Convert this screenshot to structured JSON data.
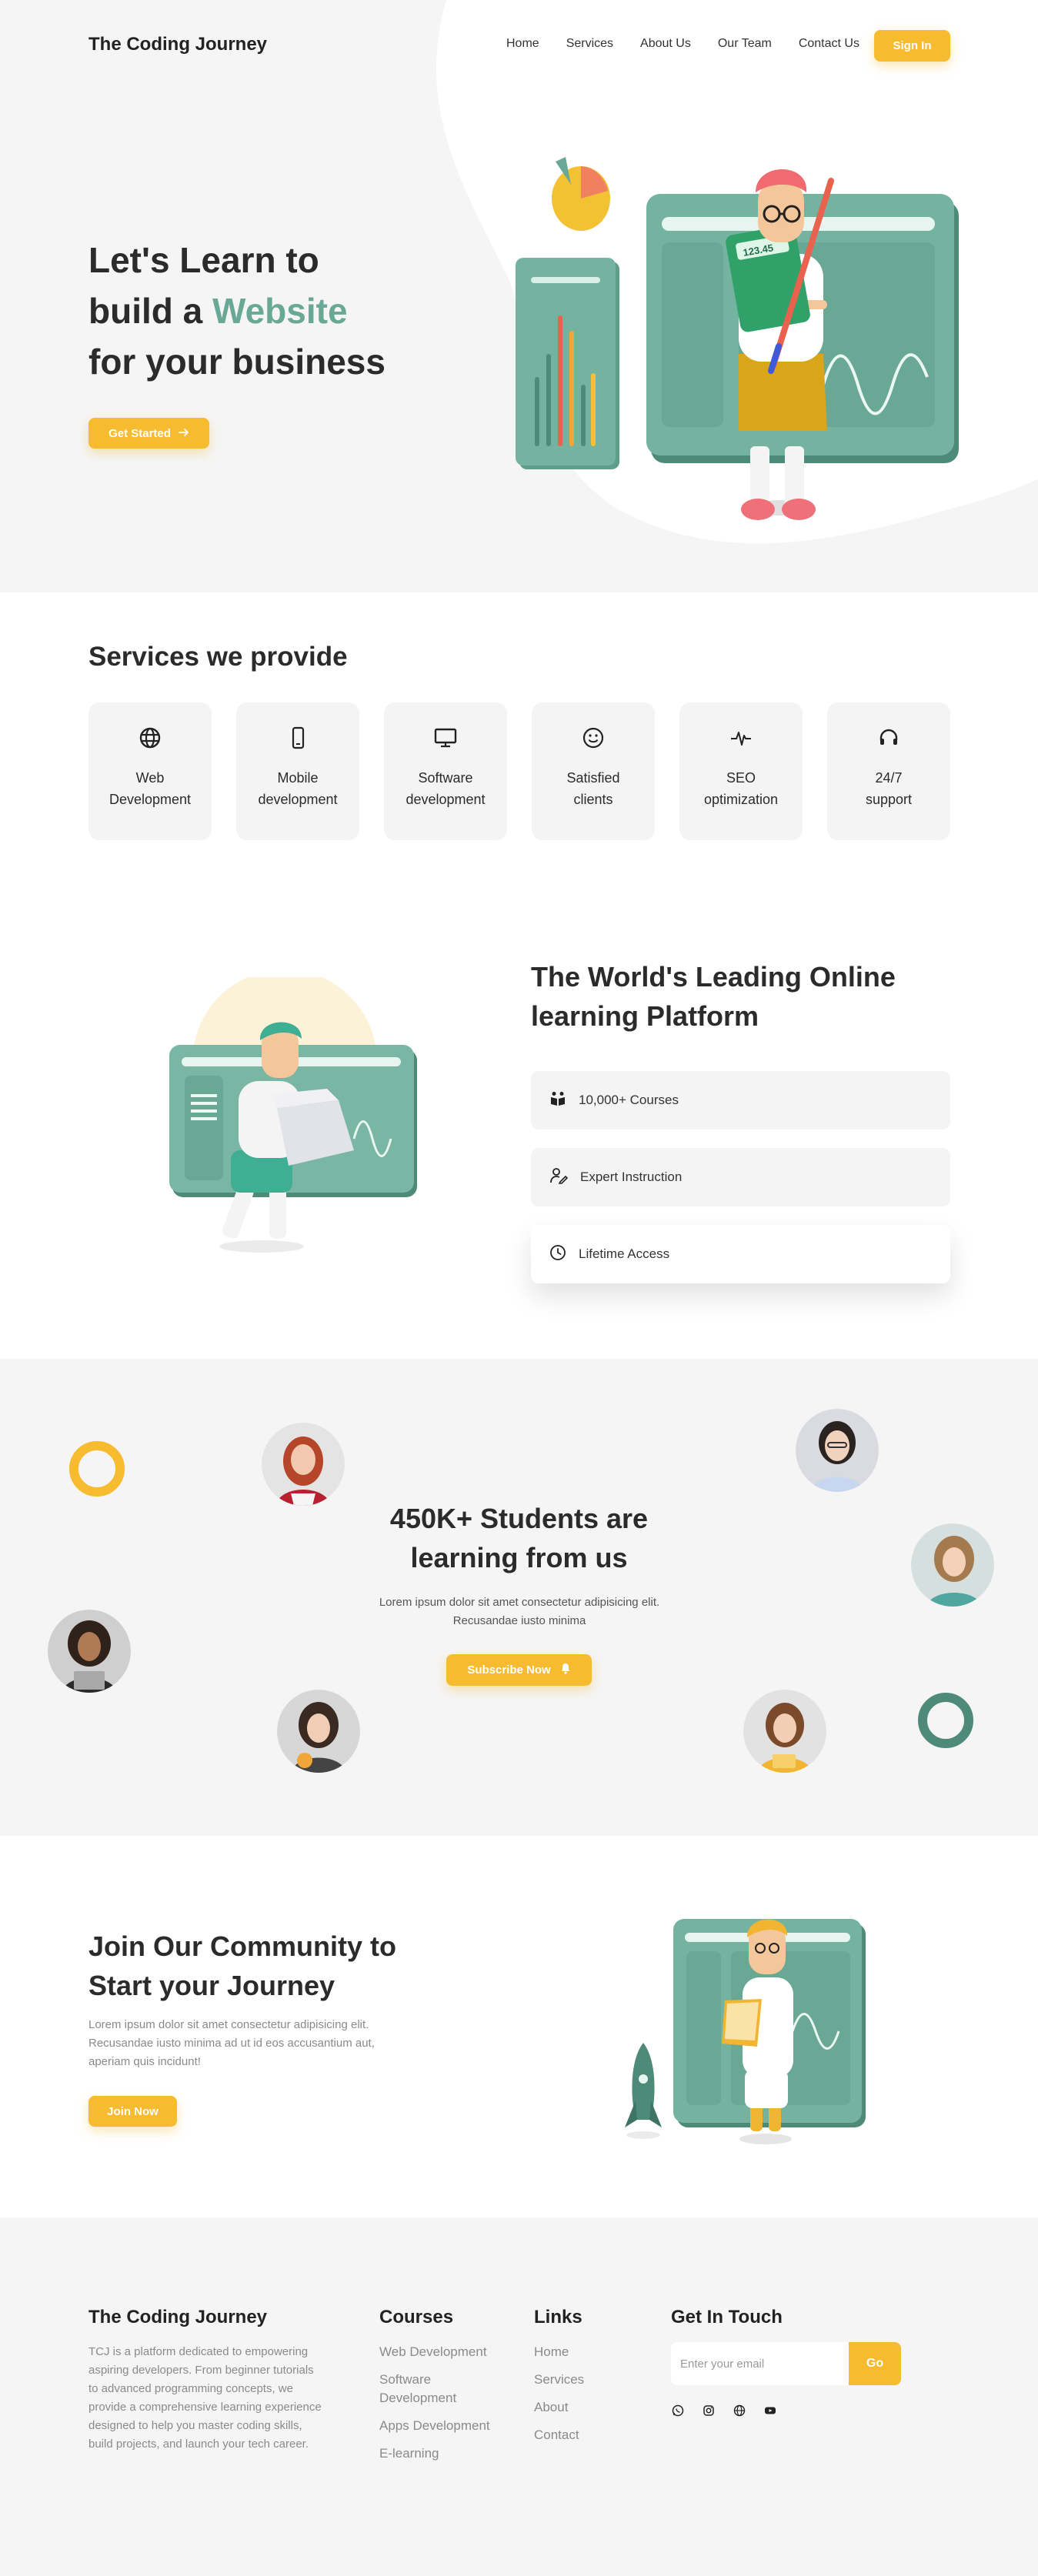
{
  "header": {
    "brand": "The Coding Journey",
    "nav": [
      "Home",
      "Services",
      "About Us",
      "Our Team",
      "Contact Us"
    ],
    "signin": "Sign In"
  },
  "hero": {
    "line1": "Let's Learn to",
    "line2_pre": "build a ",
    "line2_accent": "Website",
    "line3": "for your business",
    "cta": "Get Started",
    "calc_display": "123.45"
  },
  "services": {
    "title": "Services we provide",
    "items": [
      {
        "label": "Web\nDevelopment",
        "icon": "globe-icon"
      },
      {
        "label": "Mobile\ndevelopment",
        "icon": "mobile-icon"
      },
      {
        "label": "Software\ndevelopment",
        "icon": "monitor-icon"
      },
      {
        "label": "Satisfied\nclients",
        "icon": "smile-icon"
      },
      {
        "label": "SEO\noptimization",
        "icon": "pulse-icon"
      },
      {
        "label": "24/7\nsupport",
        "icon": "headset-icon"
      }
    ]
  },
  "platform": {
    "title": "The World's Leading Online learning Platform",
    "features": [
      {
        "label": "10,000+ Courses",
        "icon": "book-icon"
      },
      {
        "label": "Expert Instruction",
        "icon": "instructor-icon"
      },
      {
        "label": "Lifetime Access",
        "icon": "clock-icon"
      }
    ]
  },
  "students": {
    "title": "450K+ Students are learning from us",
    "text": "Lorem ipsum dolor sit amet consectetur adipisicing elit. Recusandae iusto minima",
    "cta": "Subscribe Now"
  },
  "community": {
    "title": "Join Our Community to Start your Journey",
    "text": "Lorem ipsum dolor sit amet consectetur adipisicing elit. Recusandae iusto minima ad ut id eos accusantium aut, aperiam quis incidunt!",
    "cta": "Join Now"
  },
  "footer": {
    "brand": "The Coding Journey",
    "about": "TCJ is a platform dedicated to empowering aspiring developers. From beginner tutorials to advanced programming concepts, we provide a comprehensive learning experience designed to help you master coding skills, build projects, and launch your tech career.",
    "courses_head": "Courses",
    "courses": [
      "Web Development",
      "Software Development",
      "Apps Development",
      "E-learning"
    ],
    "links_head": "Links",
    "links": [
      "Home",
      "Services",
      "About",
      "Contact"
    ],
    "contact_head": "Get In Touch",
    "email_placeholder": "Enter your email",
    "go": "Go",
    "social": [
      "whatsapp-icon",
      "instagram-icon",
      "globe-icon",
      "youtube-icon"
    ]
  },
  "colors": {
    "accent_yellow": "#f7bb2f",
    "accent_teal": "#6aa896",
    "dark_teal": "#4e8a78",
    "bg_gray": "#f5f5f5"
  }
}
